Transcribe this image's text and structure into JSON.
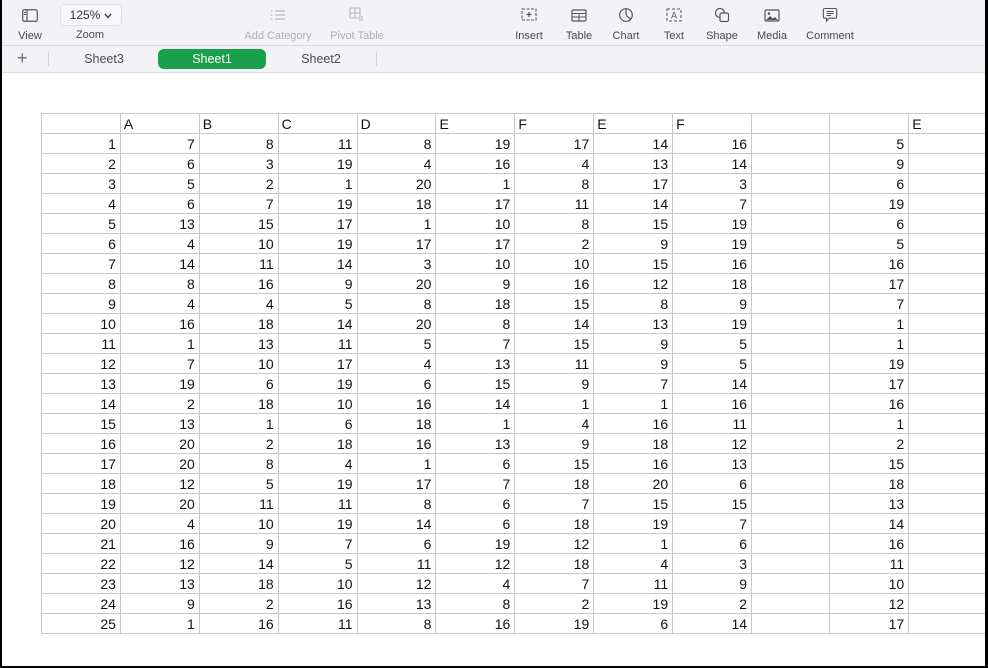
{
  "toolbar": {
    "view": {
      "label": "View",
      "icon": "sidebar-icon"
    },
    "zoom": {
      "value": "125%",
      "label": "Zoom",
      "icon": "chevron-down-icon"
    },
    "add_category": {
      "label": "Add Category",
      "icon": "list-icon",
      "enabled": false
    },
    "pivot_table": {
      "label": "Pivot Table",
      "icon": "pivot-table-icon",
      "enabled": false
    },
    "insert": {
      "label": "Insert",
      "icon": "insert-icon"
    },
    "table": {
      "label": "Table",
      "icon": "table-icon"
    },
    "chart": {
      "label": "Chart",
      "icon": "chart-icon"
    },
    "text": {
      "label": "Text",
      "icon": "text-box-icon"
    },
    "shape": {
      "label": "Shape",
      "icon": "shape-icon"
    },
    "media": {
      "label": "Media",
      "icon": "media-icon"
    },
    "comment": {
      "label": "Comment",
      "icon": "comment-icon"
    }
  },
  "sheets": {
    "add_label": "+",
    "tabs": [
      {
        "label": "Sheet3",
        "active": false
      },
      {
        "label": "Sheet1",
        "active": true
      },
      {
        "label": "Sheet2",
        "active": false
      }
    ],
    "active_color": "#1aa04a"
  },
  "table": {
    "headers": [
      "",
      "A",
      "B",
      "C",
      "D",
      "E",
      "F",
      "E",
      "F",
      "",
      "",
      "E"
    ],
    "rows": [
      [
        "1",
        "7",
        "8",
        "11",
        "8",
        "19",
        "17",
        "14",
        "16",
        "",
        "5",
        ""
      ],
      [
        "2",
        "6",
        "3",
        "19",
        "4",
        "16",
        "4",
        "13",
        "14",
        "",
        "9",
        ""
      ],
      [
        "3",
        "5",
        "2",
        "1",
        "20",
        "1",
        "8",
        "17",
        "3",
        "",
        "6",
        ""
      ],
      [
        "4",
        "6",
        "7",
        "19",
        "18",
        "17",
        "11",
        "14",
        "7",
        "",
        "19",
        ""
      ],
      [
        "5",
        "13",
        "15",
        "17",
        "1",
        "10",
        "8",
        "15",
        "19",
        "",
        "6",
        ""
      ],
      [
        "6",
        "4",
        "10",
        "19",
        "17",
        "17",
        "2",
        "9",
        "19",
        "",
        "5",
        ""
      ],
      [
        "7",
        "14",
        "11",
        "14",
        "3",
        "10",
        "10",
        "15",
        "16",
        "",
        "16",
        ""
      ],
      [
        "8",
        "8",
        "16",
        "9",
        "20",
        "9",
        "16",
        "12",
        "18",
        "",
        "17",
        ""
      ],
      [
        "9",
        "4",
        "4",
        "5",
        "8",
        "18",
        "15",
        "8",
        "9",
        "",
        "7",
        ""
      ],
      [
        "10",
        "16",
        "18",
        "14",
        "20",
        "8",
        "14",
        "13",
        "19",
        "",
        "1",
        ""
      ],
      [
        "11",
        "1",
        "13",
        "11",
        "5",
        "7",
        "15",
        "9",
        "5",
        "",
        "1",
        ""
      ],
      [
        "12",
        "7",
        "10",
        "17",
        "4",
        "13",
        "11",
        "9",
        "5",
        "",
        "19",
        ""
      ],
      [
        "13",
        "19",
        "6",
        "19",
        "6",
        "15",
        "9",
        "7",
        "14",
        "",
        "17",
        ""
      ],
      [
        "14",
        "2",
        "18",
        "10",
        "16",
        "14",
        "1",
        "1",
        "16",
        "",
        "16",
        ""
      ],
      [
        "15",
        "13",
        "1",
        "6",
        "18",
        "1",
        "4",
        "16",
        "11",
        "",
        "1",
        ""
      ],
      [
        "16",
        "20",
        "2",
        "18",
        "16",
        "13",
        "9",
        "18",
        "12",
        "",
        "2",
        ""
      ],
      [
        "17",
        "20",
        "8",
        "4",
        "1",
        "6",
        "15",
        "16",
        "13",
        "",
        "15",
        ""
      ],
      [
        "18",
        "12",
        "5",
        "19",
        "17",
        "7",
        "18",
        "20",
        "6",
        "",
        "18",
        ""
      ],
      [
        "19",
        "20",
        "11",
        "11",
        "8",
        "6",
        "7",
        "15",
        "15",
        "",
        "13",
        ""
      ],
      [
        "20",
        "4",
        "10",
        "19",
        "14",
        "6",
        "18",
        "19",
        "7",
        "",
        "14",
        ""
      ],
      [
        "21",
        "16",
        "9",
        "7",
        "6",
        "19",
        "12",
        "1",
        "6",
        "",
        "16",
        ""
      ],
      [
        "22",
        "12",
        "14",
        "5",
        "11",
        "12",
        "18",
        "4",
        "3",
        "",
        "11",
        ""
      ],
      [
        "23",
        "13",
        "18",
        "10",
        "12",
        "4",
        "7",
        "11",
        "9",
        "",
        "10",
        ""
      ],
      [
        "24",
        "9",
        "2",
        "16",
        "13",
        "8",
        "2",
        "19",
        "2",
        "",
        "12",
        ""
      ],
      [
        "25",
        "1",
        "16",
        "11",
        "8",
        "16",
        "19",
        "6",
        "14",
        "",
        "17",
        ""
      ]
    ]
  }
}
